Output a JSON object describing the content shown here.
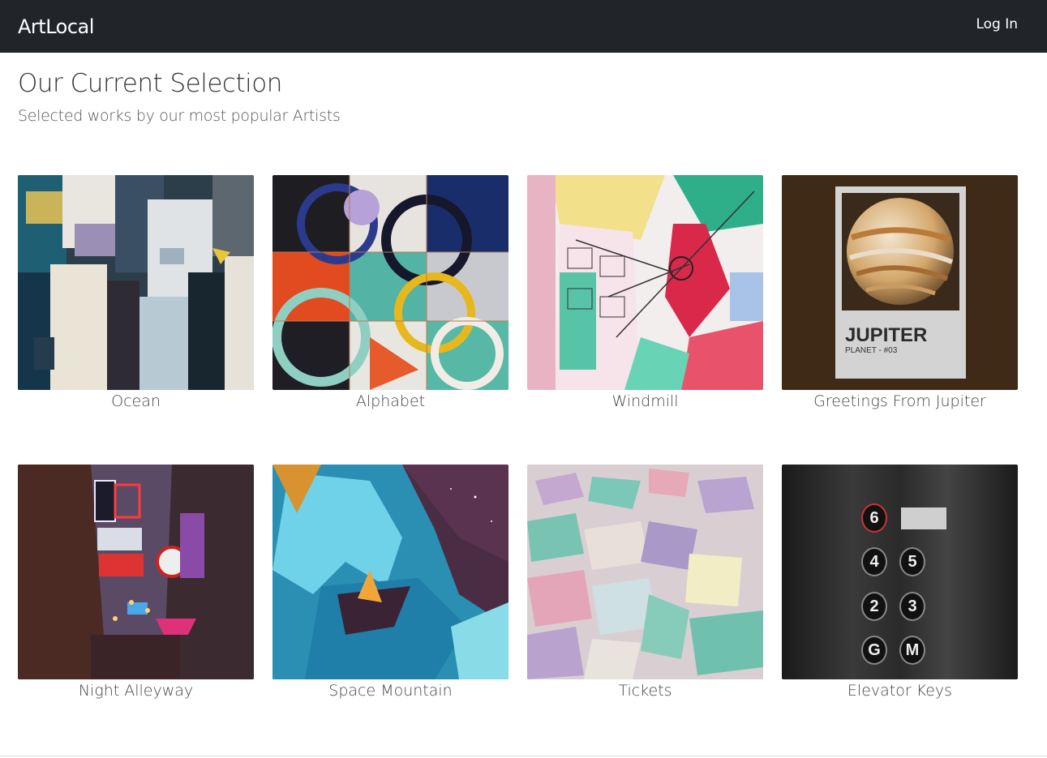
{
  "navbar": {
    "brand": "ArtLocal",
    "login_label": "Log In"
  },
  "header": {
    "title": "Our Current Selection",
    "subtitle": "Selected works by our most popular Artists"
  },
  "artworks": [
    {
      "title": "Ocean",
      "image": "abstract-painting-image"
    },
    {
      "title": "Alphabet",
      "image": "geometric-circles-image"
    },
    {
      "title": "Windmill",
      "image": "windmill-illustration-image"
    },
    {
      "title": "Greetings From Jupiter",
      "image": "jupiter-poster-image",
      "poster_title": "JUPITER",
      "poster_subtitle": "PLANET - #03"
    },
    {
      "title": "Night Alleyway",
      "image": "neon-alley-photo"
    },
    {
      "title": "Space Mountain",
      "image": "blue-rock-arch-image"
    },
    {
      "title": "Tickets",
      "image": "paper-scraps-photo"
    },
    {
      "title": "Elevator Keys",
      "image": "elevator-buttons-photo",
      "buttons": [
        "6",
        "4",
        "5",
        "2",
        "3",
        "G",
        "M"
      ]
    }
  ],
  "colors": {
    "navbar": "#212529",
    "page_bg": "#ffffff",
    "text": "#333333"
  }
}
